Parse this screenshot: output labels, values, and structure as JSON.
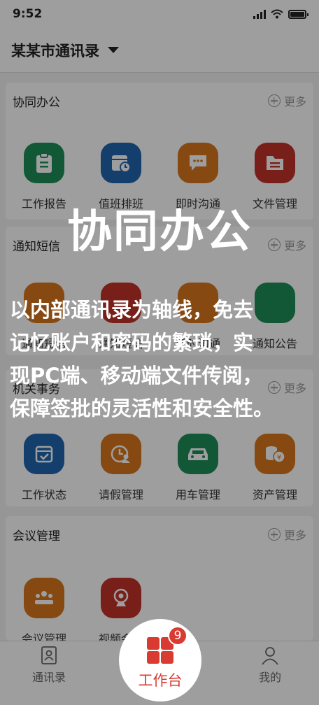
{
  "status": {
    "time": "9:52"
  },
  "header": {
    "title": "某某市通讯录"
  },
  "sections": [
    {
      "title": "协同办公",
      "more": "更多",
      "items": [
        {
          "label": "工作报告",
          "icon": "clipboard-icon",
          "color": "#1d8f5a"
        },
        {
          "label": "值班排班",
          "icon": "calendar-clock-icon",
          "color": "#2166b0"
        },
        {
          "label": "即时沟通",
          "icon": "chat-icon",
          "color": "#d9761c"
        },
        {
          "label": "文件管理",
          "icon": "folder-icon",
          "color": "#c4322b"
        }
      ]
    },
    {
      "title": "通知短信",
      "more": "更多",
      "items": [
        {
          "label": "通知短信",
          "icon": "message-icon",
          "color": "#d9761c"
        },
        {
          "label": "通知短信",
          "icon": "home-icon",
          "color": "#c4322b"
        },
        {
          "label": "即时沟通",
          "icon": "chat-icon",
          "color": "#d9761c"
        },
        {
          "label": "通知公告",
          "icon": "bell-icon",
          "color": "#1d8f5a"
        }
      ]
    },
    {
      "title": "机关事务",
      "more": "更多",
      "items": [
        {
          "label": "工作状态",
          "icon": "calendar-check-icon",
          "color": "#2166b0"
        },
        {
          "label": "请假管理",
          "icon": "person-clock-icon",
          "color": "#d9761c"
        },
        {
          "label": "用车管理",
          "icon": "car-icon",
          "color": "#1d8f5a"
        },
        {
          "label": "资产管理",
          "icon": "coins-icon",
          "color": "#d9761c"
        }
      ]
    },
    {
      "title": "会议管理",
      "more": "更多",
      "items": [
        {
          "label": "会议管理",
          "icon": "meeting-icon",
          "color": "#d9761c"
        },
        {
          "label": "视频会议",
          "icon": "webcam-icon",
          "color": "#c4322b"
        }
      ]
    }
  ],
  "tabs": {
    "contacts": "通讯录",
    "workbench": "工作台",
    "mine": "我的",
    "badge": "9"
  },
  "overlay": {
    "title": "协同办公",
    "lines": [
      "以内部通讯录为轴线，免去",
      "记忆账户和密码的繁琐，实",
      "现PC端、移动端文件传阅，",
      "保障签批的灵活性和安全性。"
    ]
  }
}
